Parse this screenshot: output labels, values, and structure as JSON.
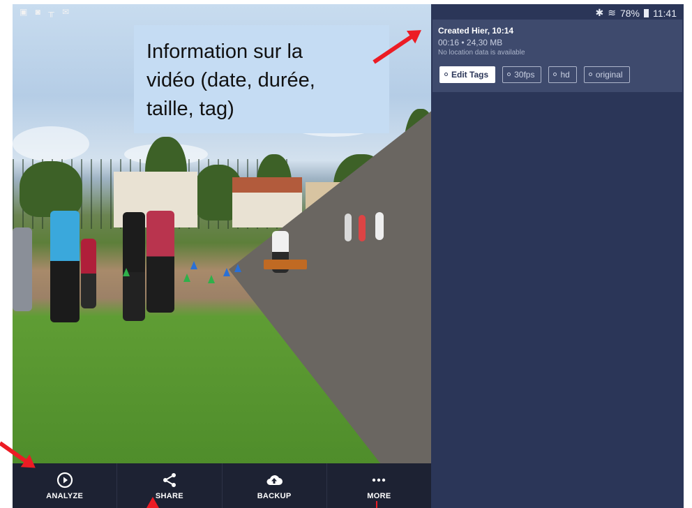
{
  "status_left_icons": [
    "image-icon",
    "lock-icon",
    "signal-icon",
    "mail-icon"
  ],
  "status": {
    "battery": "78%",
    "time": "11:41"
  },
  "info": {
    "created": "Created Hier, 10:14",
    "meta": "00:16 • 24,30 MB",
    "location": "No location data is available"
  },
  "tags": [
    {
      "label": "Edit Tags",
      "primary": true
    },
    {
      "label": "30fps",
      "primary": false
    },
    {
      "label": "hd",
      "primary": false
    },
    {
      "label": "original",
      "primary": false
    }
  ],
  "toolbar": {
    "analyze": "ANALYZE",
    "share": "SHARE",
    "backup": "BACKUP",
    "more": "MORE"
  },
  "annotation": {
    "line1": "Information sur la",
    "line2": "vidéo (date, durée,",
    "line3": "taille, tag)"
  },
  "colors": {
    "panel": "#2b3658",
    "card": "#3e4a6d",
    "toolbar": "#1d2233",
    "arrow": "#ec1c24",
    "annotation_bg": "#c5dcf3"
  }
}
